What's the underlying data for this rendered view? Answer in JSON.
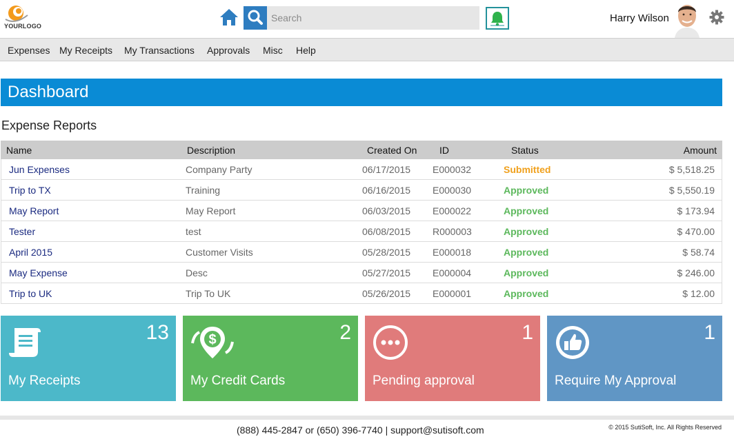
{
  "header": {
    "logo_text": "YOURLOGO",
    "search_placeholder": "Search",
    "user_name": "Harry Wilson"
  },
  "menu": [
    "Expenses",
    "My Receipts",
    "My Transactions",
    "Approvals",
    "Misc",
    "Help"
  ],
  "dashboard": {
    "title": "Dashboard"
  },
  "expense_reports": {
    "title": "Expense Reports",
    "columns": [
      "Name",
      "Description",
      "Created On",
      "ID",
      "Status",
      "Amount"
    ],
    "rows": [
      {
        "name": "Jun Expenses",
        "description": "Company Party",
        "created_on": "06/17/2015",
        "id": "E000032",
        "status": "Submitted",
        "amount": "$ 5,518.25"
      },
      {
        "name": "Trip to TX",
        "description": "Training",
        "created_on": "06/16/2015",
        "id": "E000030",
        "status": "Approved",
        "amount": "$ 5,550.19"
      },
      {
        "name": "May Report",
        "description": "May Report",
        "created_on": "06/03/2015",
        "id": "E000022",
        "status": "Approved",
        "amount": "$ 173.94"
      },
      {
        "name": "Tester",
        "description": "test",
        "created_on": "06/08/2015",
        "id": "R000003",
        "status": "Approved",
        "amount": "$ 470.00"
      },
      {
        "name": "April 2015",
        "description": "Customer Visits",
        "created_on": "05/28/2015",
        "id": "E000018",
        "status": "Approved",
        "amount": "$ 58.74"
      },
      {
        "name": "May Expense",
        "description": "Desc",
        "created_on": "05/27/2015",
        "id": "E000004",
        "status": "Approved",
        "amount": "$ 246.00"
      },
      {
        "name": "Trip to UK",
        "description": "Trip To UK",
        "created_on": "05/26/2015",
        "id": "E000001",
        "status": "Approved",
        "amount": "$ 12.00"
      }
    ]
  },
  "status_colors": {
    "Submitted": "#f0a01c",
    "Approved": "#5cb85c"
  },
  "tiles": [
    {
      "label": "My Receipts",
      "count": "13",
      "color": "#4cb8c9",
      "icon": "receipt-icon"
    },
    {
      "label": "My Credit Cards",
      "count": "2",
      "color": "#5cb85c",
      "icon": "dollar-pin-icon"
    },
    {
      "label": "Pending approval",
      "count": "1",
      "color": "#e07b7b",
      "icon": "ellipsis-circle-icon"
    },
    {
      "label": "Require My Approval",
      "count": "1",
      "color": "#6096c5",
      "icon": "thumbs-up-icon"
    }
  ],
  "footer": {
    "contact": "(888) 445-2847 or (650) 396-7740 | support@sutisoft.com",
    "copyright": "© 2015 SutiSoft, Inc. All Rights Reserved"
  }
}
